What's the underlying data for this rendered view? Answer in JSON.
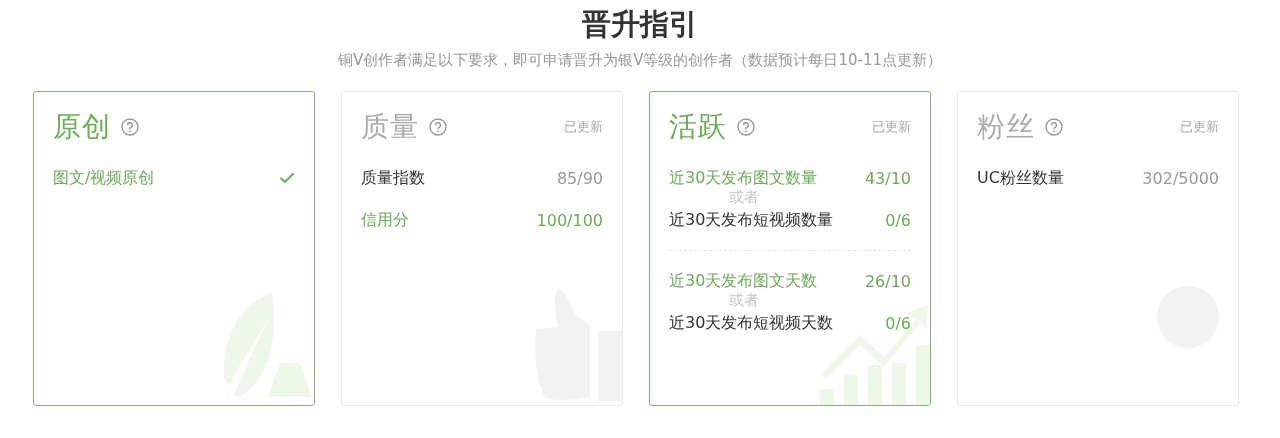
{
  "heading": "晋升指引",
  "subtitle": "铜V创作者满足以下要求，即可申请晋升为银V等级的创作者（数据预计每日10-11点更新）",
  "cards": [
    {
      "title": "原创",
      "met": true,
      "groups": [
        {
          "rows": [
            {
              "label": "图文/视频原创",
              "met": true,
              "kind": "check"
            }
          ]
        }
      ]
    },
    {
      "title": "质量",
      "met": false,
      "status": "已更新",
      "groups": [
        {
          "rows": [
            {
              "label": "质量指数",
              "value": "85/90",
              "met": false,
              "kind": "value"
            },
            {
              "label": "信用分",
              "value": "100/100",
              "met": true,
              "kind": "value"
            }
          ]
        }
      ]
    },
    {
      "title": "活跃",
      "met": true,
      "status": "已更新",
      "groups": [
        {
          "joiner": "或者",
          "rows": [
            {
              "label": "近30天发布图文数量",
              "value": "43/10",
              "met": true,
              "kind": "value"
            },
            {
              "label": "近30天发布短视频数量",
              "value": "0/6",
              "met": false,
              "kind": "value"
            }
          ]
        },
        {
          "joiner": "或者",
          "rows": [
            {
              "label": "近30天发布图文天数",
              "value": "26/10",
              "met": true,
              "kind": "value"
            },
            {
              "label": "近30天发布短视频天数",
              "value": "0/6",
              "met": false,
              "kind": "value"
            }
          ]
        }
      ]
    },
    {
      "title": "粉丝",
      "met": false,
      "status": "已更新",
      "groups": [
        {
          "rows": [
            {
              "label": "UC粉丝数量",
              "value": "302/5000",
              "met": false,
              "kind": "value"
            }
          ]
        }
      ]
    }
  ]
}
